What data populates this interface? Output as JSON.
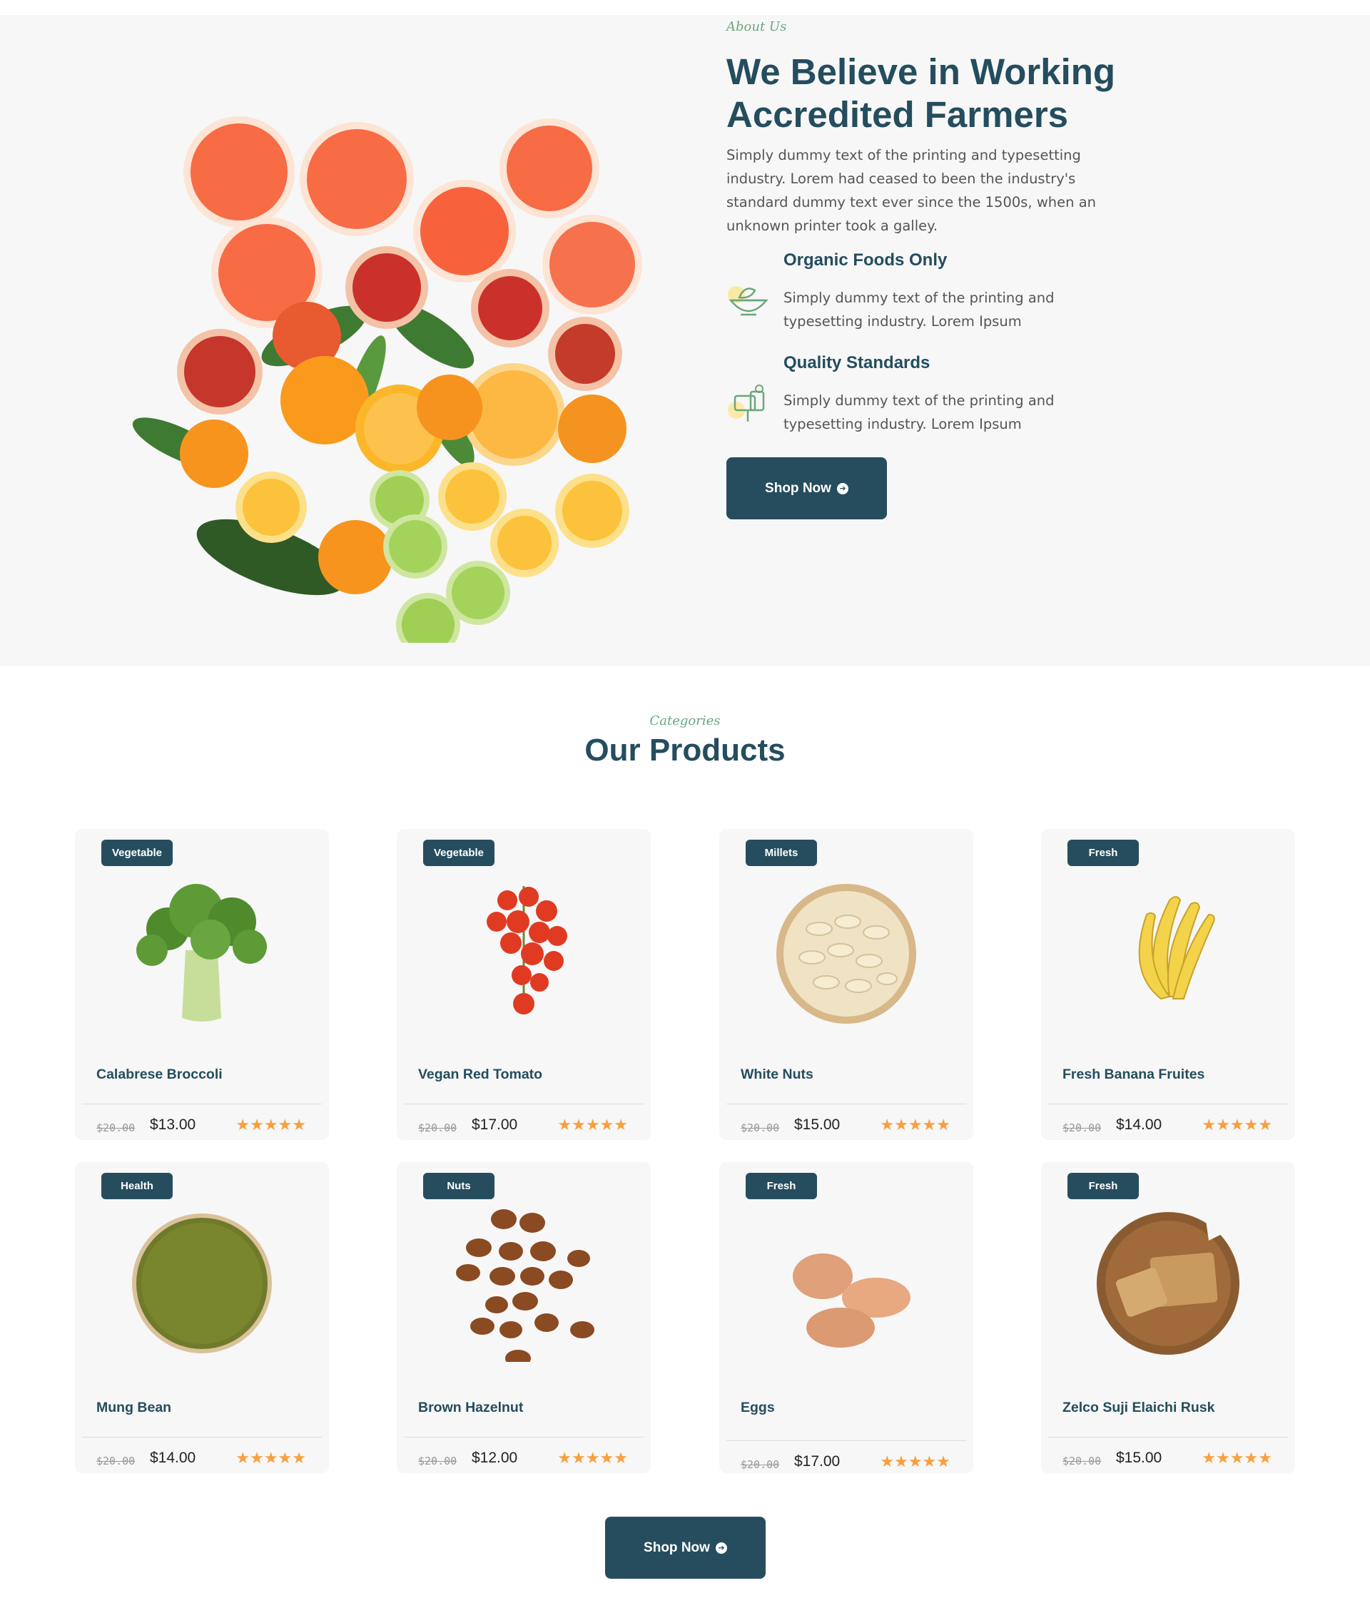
{
  "about": {
    "eyebrow": "About Us",
    "title_line1": "We Believe in Working",
    "title_line2": "Accredited Farmers",
    "description": "Simply dummy text of the printing and typesetting industry. Lorem had ceased to been the industry's standard dummy text ever since the 1500s, when an unknown printer took a galley.",
    "features": [
      {
        "title": "Organic Foods Only",
        "text": "Simply dummy text of the printing and typesetting industry. Lorem Ipsum",
        "icon": "organic-bowl-icon"
      },
      {
        "title": "Quality Standards",
        "text": "Simply dummy text of the printing and typesetting industry. Lorem Ipsum",
        "icon": "quality-mailbox-icon"
      }
    ],
    "button_label": "Shop Now"
  },
  "products": {
    "eyebrow": "Categories",
    "title": "Our Products",
    "items": [
      {
        "badge": "Vegetable",
        "name": "Calabrese Broccoli",
        "old_price": "$20.00",
        "price": "$13.00",
        "rating": 5,
        "image": "broccoli"
      },
      {
        "badge": "Vegetable",
        "name": "Vegan Red Tomato",
        "old_price": "$20.00",
        "price": "$17.00",
        "rating": 5,
        "image": "tomato"
      },
      {
        "badge": "Millets",
        "name": "White Nuts",
        "old_price": "$20.00",
        "price": "$15.00",
        "rating": 5,
        "image": "cashews"
      },
      {
        "badge": "Fresh",
        "name": "Fresh Banana Fruites",
        "old_price": "$20.00",
        "price": "$14.00",
        "rating": 5,
        "image": "banana"
      },
      {
        "badge": "Health",
        "name": "Mung Bean",
        "old_price": "$20.00",
        "price": "$14.00",
        "rating": 5,
        "image": "mung-bean"
      },
      {
        "badge": "Nuts",
        "name": "Brown Hazelnut",
        "old_price": "$20.00",
        "price": "$12.00",
        "rating": 5,
        "image": "hazelnut"
      },
      {
        "badge": "Fresh",
        "name": "Eggs",
        "old_price": "$20.00",
        "price": "$17.00",
        "rating": 5,
        "image": "eggs"
      },
      {
        "badge": "Fresh",
        "name": "Zelco Suji Elaichi Rusk",
        "old_price": "$20.00",
        "price": "$15.00",
        "rating": 5,
        "image": "rusk"
      }
    ],
    "stars_text": "★★★★★",
    "button_label": "Shop Now"
  },
  "colors": {
    "primary": "#264d5e",
    "accent_green": "#6aa77c",
    "star": "#f7a03e",
    "card_bg": "#f7f7f7"
  }
}
